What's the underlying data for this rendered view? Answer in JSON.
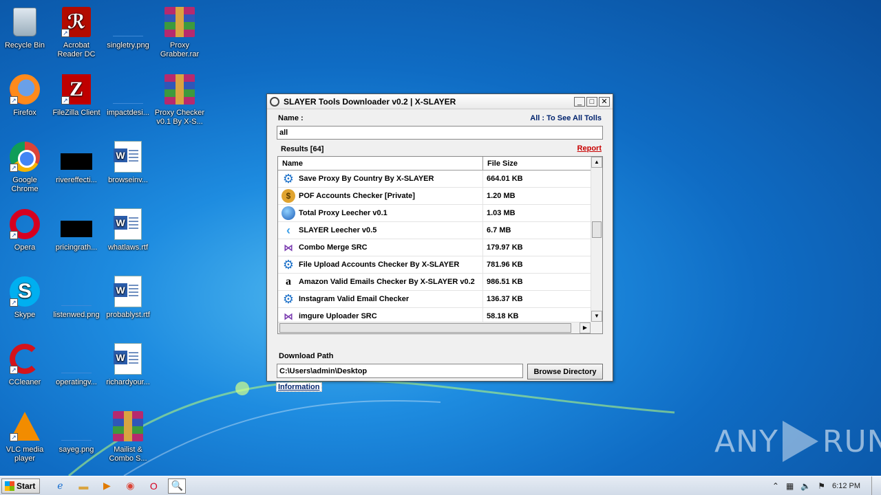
{
  "desktop": {
    "icons": [
      {
        "label": "Recycle Bin",
        "icon": "recycle-bin-icon"
      },
      {
        "label": "Acrobat Reader DC",
        "icon": "acrobat-icon"
      },
      {
        "label": "singletry.png",
        "icon": "image-file-icon"
      },
      {
        "label": "Proxy Grabber.rar",
        "icon": "winrar-icon"
      },
      {
        "label": "Firefox",
        "icon": "firefox-icon"
      },
      {
        "label": "FileZilla Client",
        "icon": "filezilla-icon"
      },
      {
        "label": "impactdesi...",
        "icon": "image-file-icon"
      },
      {
        "label": "Proxy Checker v0.1 By X-S...",
        "icon": "winrar-icon"
      },
      {
        "label": "Google Chrome",
        "icon": "chrome-icon"
      },
      {
        "label": "rivereffecti...",
        "icon": "image-file-icon"
      },
      {
        "label": "browseinv...",
        "icon": "word-doc-icon"
      },
      {
        "label": "Opera",
        "icon": "opera-icon"
      },
      {
        "label": "pricingrath...",
        "icon": "image-file-icon"
      },
      {
        "label": "whatlaws.rtf",
        "icon": "word-doc-icon"
      },
      {
        "label": "Skype",
        "icon": "skype-icon"
      },
      {
        "label": "listenwed.png",
        "icon": "image-file-icon"
      },
      {
        "label": "probablyst.rtf",
        "icon": "word-doc-icon"
      },
      {
        "label": "CCleaner",
        "icon": "ccleaner-icon"
      },
      {
        "label": "operatingv...",
        "icon": "image-file-icon"
      },
      {
        "label": "richardyour...",
        "icon": "word-doc-icon"
      },
      {
        "label": "VLC media player",
        "icon": "vlc-icon"
      },
      {
        "label": "sayeg.png",
        "icon": "image-file-icon"
      },
      {
        "label": "Mailist & Combo S...",
        "icon": "winrar-icon"
      }
    ]
  },
  "window": {
    "title": "SLAYER Tools Downloader v0.2 | X-SLAYER",
    "name_label": "Name :",
    "all_hint": "All : To See All Tolls",
    "search_value": "all",
    "results_label": "Results [64]",
    "report_link": "Report",
    "columns": [
      "Name",
      "File Size"
    ],
    "rows": [
      {
        "name": "Save Proxy By Country By X-SLAYER",
        "size": "664.01 KB",
        "icon": "gear-icon"
      },
      {
        "name": "POF Accounts Checker [Private]",
        "size": "1.20 MB",
        "icon": "money-bag-icon"
      },
      {
        "name": "Total Proxy Leecher v0.1",
        "size": "1.03 MB",
        "icon": "globe-icon"
      },
      {
        "name": "SLAYER Leecher v0.5",
        "size": "6.7 MB",
        "icon": "flutter-icon"
      },
      {
        "name": "Combo Merge SRC",
        "size": "179.97 KB",
        "icon": "visual-studio-icon"
      },
      {
        "name": "File Upload Accounts Checker By X-SLAYER",
        "size": "781.96 KB",
        "icon": "gear-icon"
      },
      {
        "name": "Amazon Valid Emails Checker By X-SLAYER v0.2",
        "size": "986.51 KB",
        "icon": "amazon-icon"
      },
      {
        "name": "Instagram Valid Email Checker",
        "size": "136.37 KB",
        "icon": "gear-icon"
      },
      {
        "name": "imgure Uploader SRC",
        "size": "58.18 KB",
        "icon": "visual-studio-icon"
      }
    ],
    "download_path_label": "Download Path",
    "download_path_value": "C:\\Users\\admin\\Desktop",
    "browse_button": "Browse Directory",
    "information_link": "Information"
  },
  "watermark": {
    "left": "ANY",
    "right": "RUN"
  },
  "taskbar": {
    "start_label": "Start",
    "clock": "6:12 PM"
  }
}
